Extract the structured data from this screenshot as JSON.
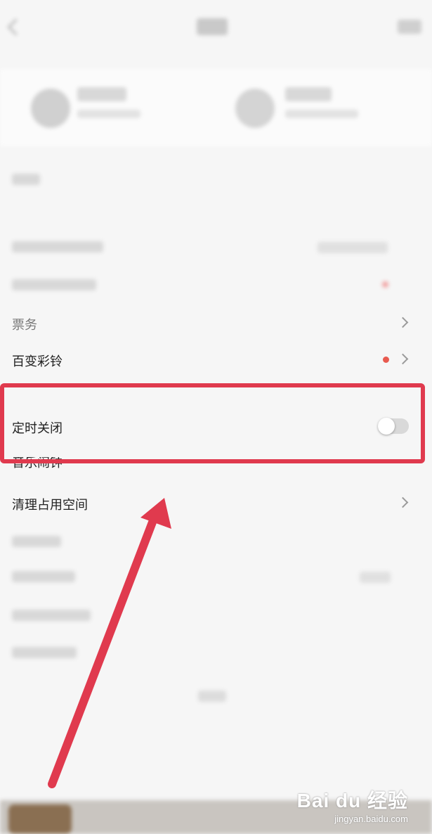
{
  "rows": {
    "tickets": {
      "label": "票务"
    },
    "ringtone": {
      "label": "百变彩铃",
      "badge_color": "#e85a4f"
    },
    "timer_close": {
      "label": "定时关闭",
      "enabled": false
    },
    "partial_hidden": {
      "label": "音乐闹钟"
    },
    "clear_space": {
      "label": "清理占用空间"
    }
  },
  "watermark": {
    "brand": "Bai du 经验",
    "sub": "jingyan.baidu.com"
  },
  "colors": {
    "highlight": "#e03a4e",
    "background": "#f6f6f6"
  }
}
